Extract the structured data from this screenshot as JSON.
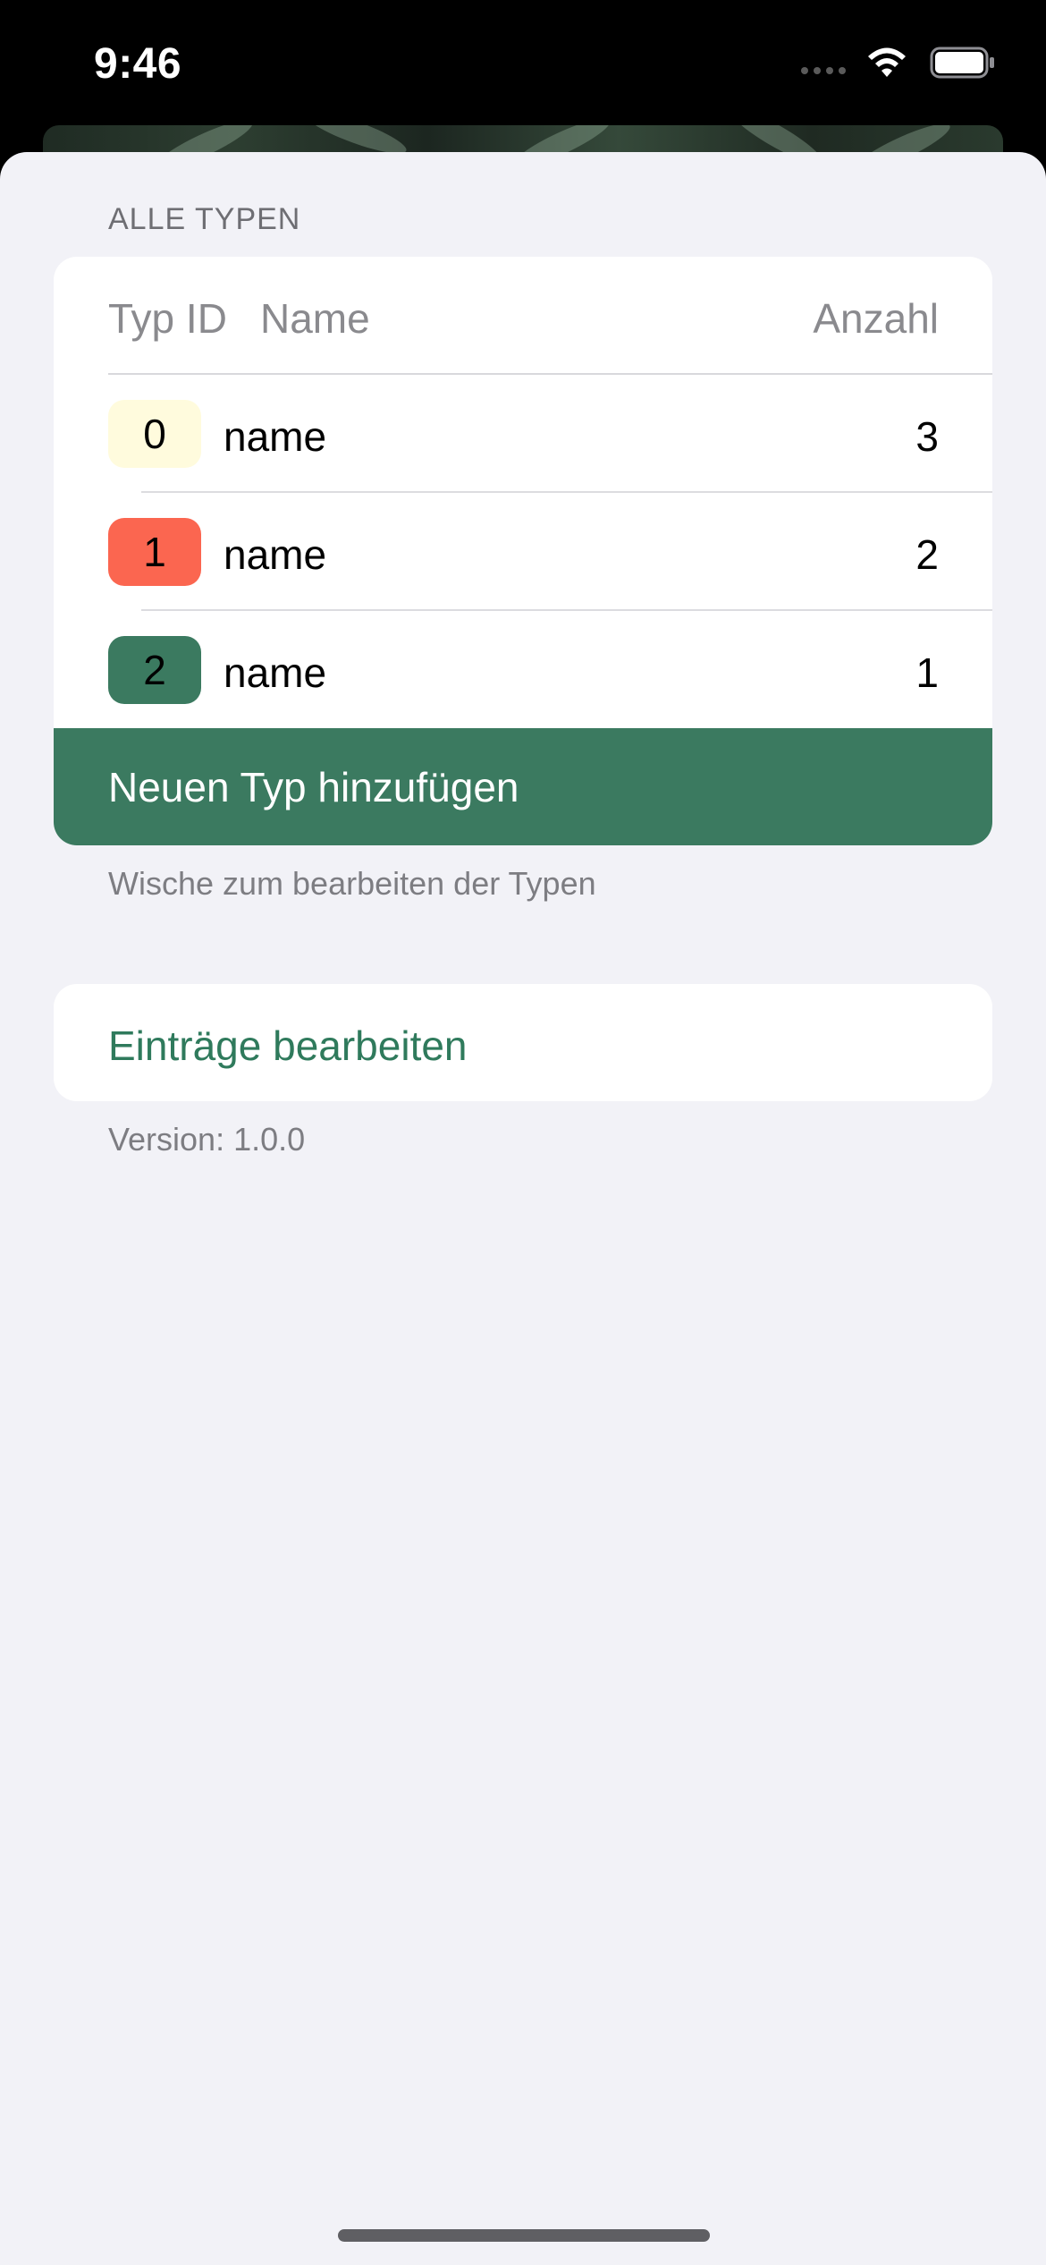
{
  "status_bar": {
    "time": "9:46"
  },
  "types_section": {
    "header": "ALLE TYPEN",
    "columns": {
      "typ_id": "Typ ID",
      "name": "Name",
      "anzahl": "Anzahl"
    },
    "rows": [
      {
        "id": "0",
        "name": "name",
        "count": "3",
        "color": "#fffbdd"
      },
      {
        "id": "1",
        "name": "name",
        "count": "2",
        "color": "#fb6650"
      },
      {
        "id": "2",
        "name": "name",
        "count": "1",
        "color": "#3b7a60"
      }
    ],
    "add_button": "Neuen Typ hinzufügen",
    "footer": "Wische zum bearbeiten der Typen"
  },
  "edit_section": {
    "link": "Einträge bearbeiten"
  },
  "version": "Version: 1.0.0",
  "colors": {
    "accent": "#3b7a60",
    "background": "#f2f2f7"
  }
}
